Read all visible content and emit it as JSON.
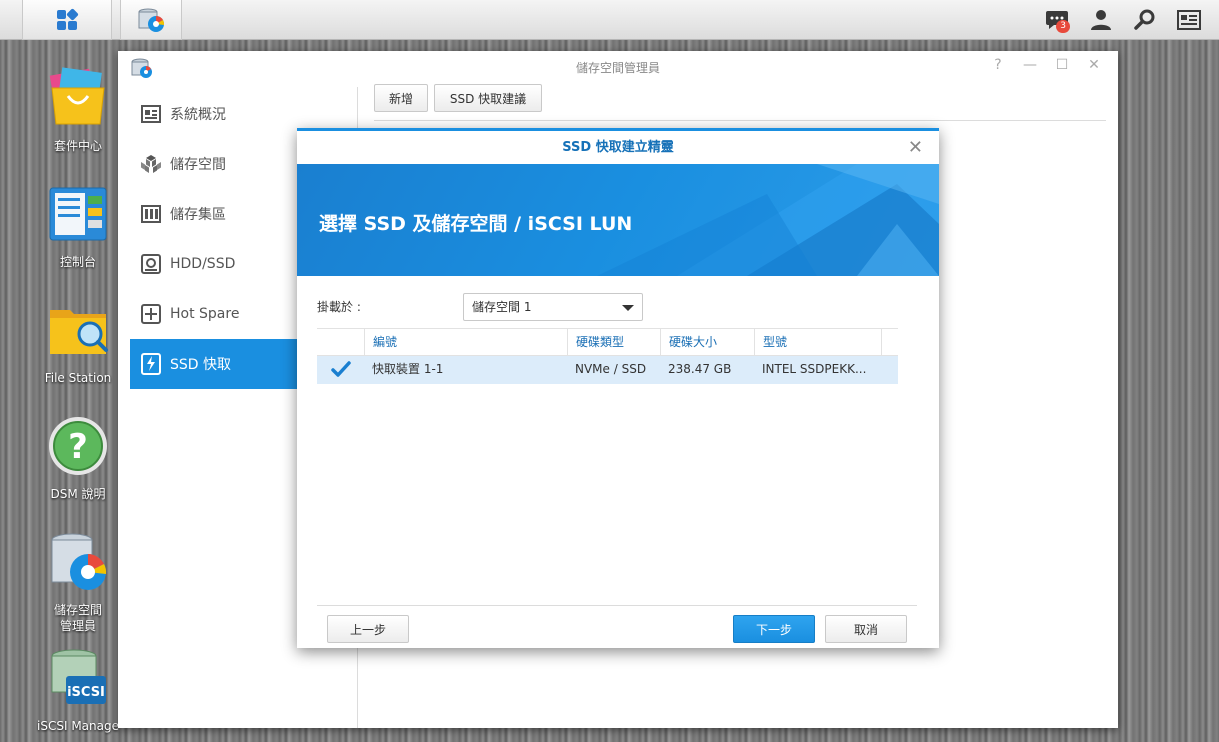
{
  "taskbar": {
    "notification_count": "3",
    "icons": [
      "main-menu-icon",
      "storage-manager-icon",
      "notification-icon",
      "user-icon",
      "search-icon",
      "widgets-icon"
    ]
  },
  "desktop": {
    "icons": [
      {
        "label": "套件中心",
        "icon": "package-center-icon"
      },
      {
        "label": "控制台",
        "icon": "control-panel-icon"
      },
      {
        "label": "File Station",
        "icon": "file-station-icon"
      },
      {
        "label": "DSM 說明",
        "icon": "help-icon"
      },
      {
        "label": "儲存空間\n管理員",
        "icon": "storage-manager-icon"
      },
      {
        "label": "iSCSI Manage",
        "icon": "iscsi-manager-icon"
      }
    ]
  },
  "main_window": {
    "title": "儲存空間管理員",
    "controls": [
      "?",
      "—",
      "☐",
      "✕"
    ],
    "sidebar": [
      {
        "label": "系統概況",
        "icon": "overview-icon",
        "active": false
      },
      {
        "label": "儲存空間",
        "icon": "volume-icon",
        "active": false
      },
      {
        "label": "儲存集區",
        "icon": "storage-pool-icon",
        "active": false
      },
      {
        "label": "HDD/SSD",
        "icon": "disk-icon",
        "active": false
      },
      {
        "label": "Hot Spare",
        "icon": "hot-spare-icon",
        "active": false
      },
      {
        "label": "SSD 快取",
        "icon": "ssd-cache-icon",
        "active": true
      }
    ],
    "toolbar": {
      "create_label": "新增",
      "advisor_label": "SSD 快取建議"
    }
  },
  "dialog": {
    "title": "SSD 快取建立精靈",
    "close": "✕",
    "banner_heading": "選擇 SSD 及儲存空間 / iSCSI LUN",
    "mount_label": "掛載於 :",
    "mount_value": "儲存空間 1",
    "columns": [
      "編號",
      "硬碟類型",
      "硬碟大小",
      "型號"
    ],
    "rows": [
      {
        "checked": true,
        "id": "快取裝置 1-1",
        "type": "NVMe / SSD",
        "size": "238.47 GB",
        "model": "INTEL SSDPEKK..."
      }
    ],
    "buttons": {
      "back": "上一步",
      "next": "下一步",
      "cancel": "取消"
    }
  }
}
